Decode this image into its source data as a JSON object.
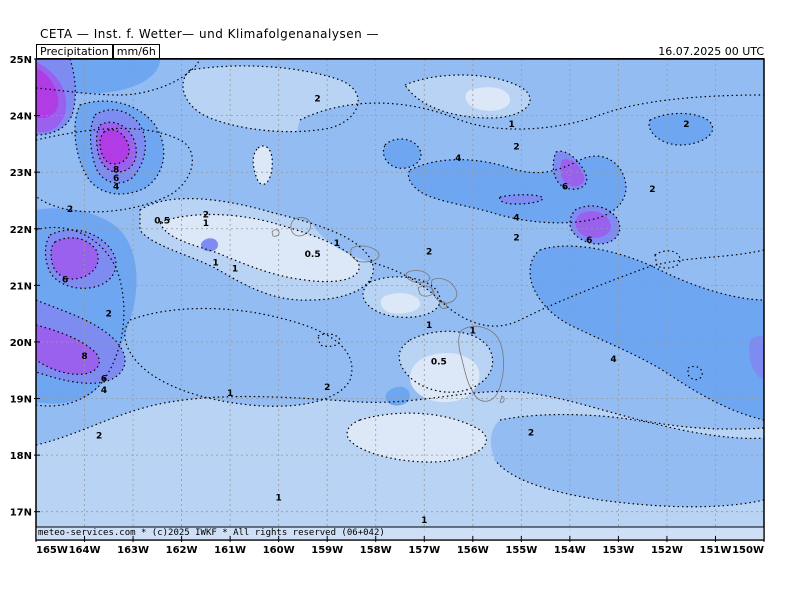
{
  "header": {
    "title": "CETA — Inst. f. Wetter— und Klimafolgenanalysen —",
    "parameter": "Precipitation",
    "unit": "mm/6h",
    "datetime": "16.07.2025 00 UTC"
  },
  "footer": {
    "text": "meteo-services.com * (c)2025 IWKF * All rights reserved (06+042)"
  },
  "map": {
    "lat_labels": [
      "25N",
      "24N",
      "23N",
      "22N",
      "21N",
      "20N",
      "19N",
      "18N",
      "17N"
    ],
    "lon_labels": [
      "165W",
      "164W",
      "163W",
      "162W",
      "161W",
      "160W",
      "159W",
      "158W",
      "157W",
      "156W",
      "155W",
      "154W",
      "153W",
      "152W",
      "151W",
      "150W"
    ],
    "colors": {
      "lt05": "#dce8f7",
      "b05_1": "#b9d3f4",
      "b1_2": "#93bcf3",
      "b2_4": "#6fa6f1",
      "b4_6": "#7e8cf2",
      "b6_8": "#9a60ee",
      "gt8": "#b03ce6",
      "grid": "#999999",
      "coast": "#777777"
    },
    "contour_labels": [
      {
        "v": "2",
        "lon": -159.2,
        "lat": 24.3
      },
      {
        "v": "1",
        "lon": -155.2,
        "lat": 23.85
      },
      {
        "v": "2",
        "lon": -155.1,
        "lat": 23.45
      },
      {
        "v": "2",
        "lon": -151.6,
        "lat": 23.85
      },
      {
        "v": "4",
        "lon": -156.3,
        "lat": 23.25
      },
      {
        "v": "6",
        "lon": -154.1,
        "lat": 22.75
      },
      {
        "v": "2",
        "lon": -152.3,
        "lat": 22.7
      },
      {
        "v": "4",
        "lon": -155.1,
        "lat": 22.2
      },
      {
        "v": "2",
        "lon": -155.1,
        "lat": 21.85
      },
      {
        "v": "6",
        "lon": -153.6,
        "lat": 21.8
      },
      {
        "v": "2",
        "lon": -156.9,
        "lat": 21.6
      },
      {
        "v": "1",
        "lon": -158.8,
        "lat": 21.75
      },
      {
        "v": "0.5",
        "lon": -159.3,
        "lat": 21.55
      },
      {
        "v": "2",
        "lon": -164.3,
        "lat": 22.35
      },
      {
        "v": "0.5",
        "lon": -162.4,
        "lat": 22.15
      },
      {
        "v": "2",
        "lon": -161.5,
        "lat": 22.25
      },
      {
        "v": "1",
        "lon": -161.5,
        "lat": 22.1
      },
      {
        "v": "1",
        "lon": -160.9,
        "lat": 21.3
      },
      {
        "v": "6",
        "lon": -164.4,
        "lat": 21.1
      },
      {
        "v": "2",
        "lon": -163.5,
        "lat": 20.5
      },
      {
        "v": "1",
        "lon": -156.9,
        "lat": 20.3
      },
      {
        "v": "1",
        "lon": -156.0,
        "lat": 20.2
      },
      {
        "v": "8",
        "lon": -164.0,
        "lat": 19.75
      },
      {
        "v": "6",
        "lon": -163.6,
        "lat": 19.35
      },
      {
        "v": "4",
        "lon": -163.6,
        "lat": 19.15
      },
      {
        "v": "0.5",
        "lon": -156.7,
        "lat": 19.65
      },
      {
        "v": "2",
        "lon": -159.0,
        "lat": 19.2
      },
      {
        "v": "1",
        "lon": -161.0,
        "lat": 19.1
      },
      {
        "v": "4",
        "lon": -153.1,
        "lat": 19.7
      },
      {
        "v": "2",
        "lon": -163.7,
        "lat": 18.35
      },
      {
        "v": "2",
        "lon": -154.8,
        "lat": 18.4
      },
      {
        "v": "1",
        "lon": -160.0,
        "lat": 17.25
      },
      {
        "v": "1",
        "lon": -157.0,
        "lat": 16.85
      },
      {
        "v": "8",
        "lon": -163.35,
        "lat": 23.05
      },
      {
        "v": "6",
        "lon": -163.35,
        "lat": 22.9
      },
      {
        "v": "4",
        "lon": -163.35,
        "lat": 22.75
      },
      {
        "v": "1",
        "lon": -161.3,
        "lat": 21.4
      }
    ]
  }
}
